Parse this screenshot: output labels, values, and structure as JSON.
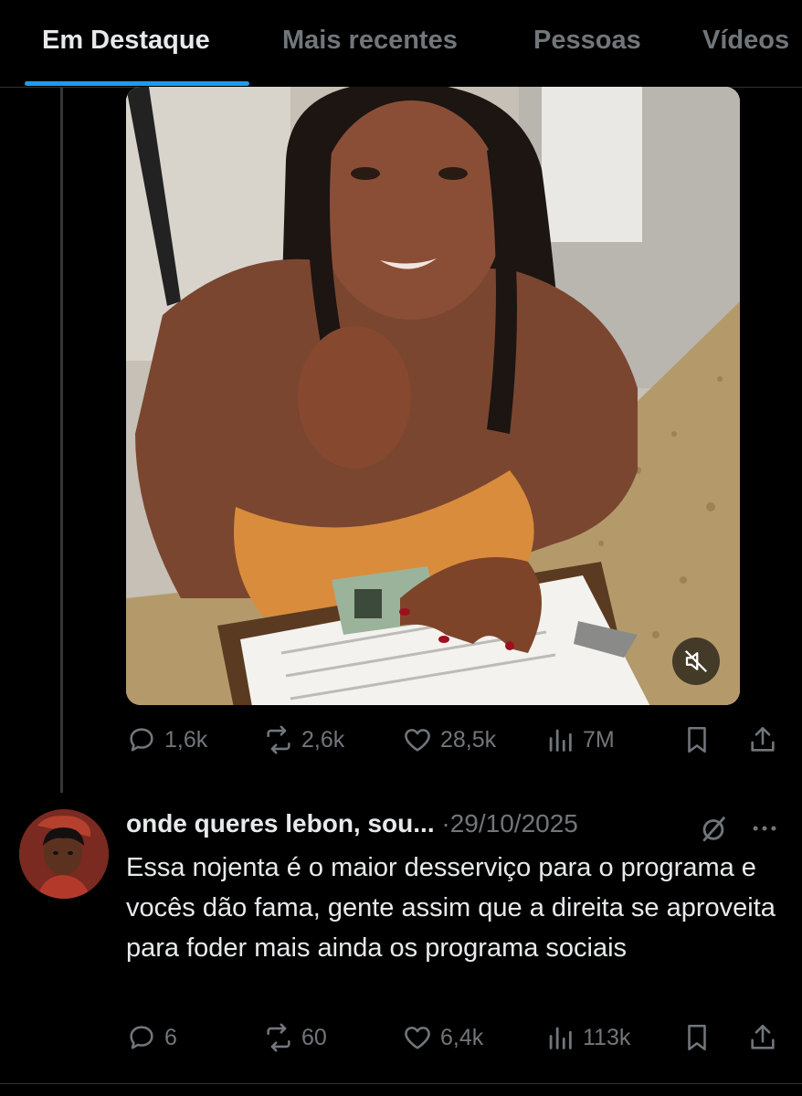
{
  "tabs": [
    {
      "label": "Em Destaque",
      "active": true
    },
    {
      "label": "Mais recentes",
      "active": false
    },
    {
      "label": "Pessoas",
      "active": false
    },
    {
      "label": "Vídeos",
      "active": false
    }
  ],
  "post": {
    "media": {
      "type": "video",
      "mute_icon": "muted-speaker-icon"
    },
    "actions": {
      "replies": "1,6k",
      "reposts": "2,6k",
      "likes": "28,5k",
      "views": "7M"
    }
  },
  "reply": {
    "author_name": "onde queres lebon, sou...",
    "separator": "·",
    "date": "29/10/2025",
    "text": "Essa nojenta é o maior desserviço para o programa e vocês dão fama, gente assim que a direita se aproveita para foder mais ainda os programa sociais",
    "actions": {
      "replies": "6",
      "reposts": "60",
      "likes": "6,4k",
      "views": "113k"
    }
  },
  "colors": {
    "background": "#000000",
    "text_primary": "#e7e9ea",
    "text_secondary": "#71767b",
    "accent": "#1d9bf0",
    "divider": "#2f3336"
  }
}
